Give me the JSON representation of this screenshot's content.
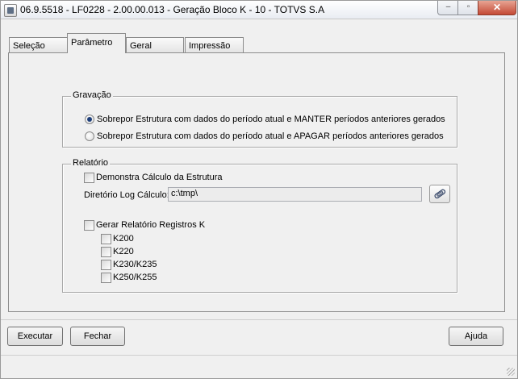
{
  "window": {
    "title": "06.9.5518 - LF0228 - 2.00.00.013 - Geração Bloco K - 10 - TOTVS S.A",
    "controls": {
      "minimize": "–",
      "maximize": "▫",
      "close": "✕"
    }
  },
  "tabs": [
    {
      "label": "Seleção",
      "active": false
    },
    {
      "label": "Parâmetro",
      "active": true
    },
    {
      "label": "Geral",
      "active": false
    },
    {
      "label": "Impressão",
      "active": false
    }
  ],
  "gravacao": {
    "title": "Gravação",
    "options": [
      {
        "label": "Sobrepor Estrutura com dados do período atual e MANTER períodos anteriores gerados",
        "selected": true
      },
      {
        "label": "Sobrepor Estrutura com dados do período atual e APAGAR períodos anteriores gerados",
        "selected": false
      }
    ]
  },
  "relatorio": {
    "title": "Relatório",
    "demonstra_calculo": {
      "label": "Demonstra Cálculo da Estrutura",
      "checked": false
    },
    "diretorio": {
      "label": "Diretório Log Cálculo:",
      "value": "c:\\tmp\\"
    },
    "gerar_relatorio": {
      "label": "Gerar Relatório Registros K",
      "checked": false
    },
    "registros": [
      {
        "label": "K200",
        "checked": false
      },
      {
        "label": "K220",
        "checked": false
      },
      {
        "label": "K230/K235",
        "checked": false
      },
      {
        "label": "K250/K255",
        "checked": false
      }
    ]
  },
  "buttons": {
    "executar": "Executar",
    "fechar": "Fechar",
    "ajuda": "Ajuda"
  },
  "icons": {
    "app": "app-icon",
    "browse": "paperclip-icon"
  },
  "colors": {
    "accent": "#1e3f7a",
    "close_button": "#c44a36"
  }
}
